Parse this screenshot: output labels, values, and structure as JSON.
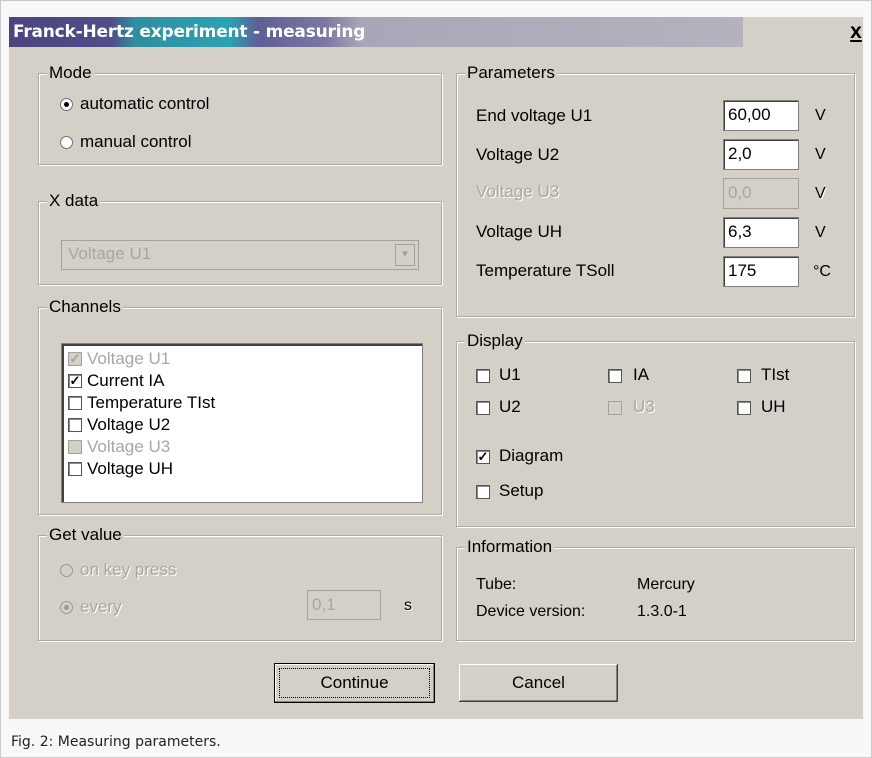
{
  "window": {
    "title": "Franck-Hertz experiment - measuring",
    "close_label": "x"
  },
  "mode": {
    "legend": "Mode",
    "options": [
      {
        "label": "automatic control",
        "selected": true
      },
      {
        "label": "manual control",
        "selected": false
      }
    ]
  },
  "x_data": {
    "legend": "X data",
    "value": "Voltage U1",
    "enabled": false
  },
  "channels": {
    "legend": "Channels",
    "items": [
      {
        "label": "Voltage U1",
        "checked": true,
        "enabled": false
      },
      {
        "label": "Current IA",
        "checked": true,
        "enabled": true
      },
      {
        "label": "Temperature TIst",
        "checked": false,
        "enabled": true
      },
      {
        "label": "Voltage U2",
        "checked": false,
        "enabled": true
      },
      {
        "label": "Voltage U3",
        "checked": false,
        "enabled": false
      },
      {
        "label": "Voltage UH",
        "checked": false,
        "enabled": true
      }
    ]
  },
  "get_value": {
    "legend": "Get value",
    "on_key_label": "on key press",
    "every_label": "every",
    "interval_value": "0,1",
    "interval_unit": "s",
    "enabled": false
  },
  "parameters": {
    "legend": "Parameters",
    "rows": [
      {
        "label": "End voltage U1",
        "value": "60,00",
        "unit": "V",
        "enabled": true
      },
      {
        "label": "Voltage U2",
        "value": "2,0",
        "unit": "V",
        "enabled": true
      },
      {
        "label": "Voltage U3",
        "value": "0,0",
        "unit": "V",
        "enabled": false
      },
      {
        "label": "Voltage UH",
        "value": "6,3",
        "unit": "V",
        "enabled": true
      },
      {
        "label": "Temperature TSoll",
        "value": "175",
        "unit": "°C",
        "enabled": true
      }
    ]
  },
  "display": {
    "legend": "Display",
    "u1": "U1",
    "ia": "IA",
    "tist": "TIst",
    "u2": "U2",
    "u3": "U3",
    "uh": "UH",
    "diagram": "Diagram",
    "setup": "Setup"
  },
  "information": {
    "legend": "Information",
    "tube_label": "Tube:",
    "tube_value": "Mercury",
    "version_label": "Device version:",
    "version_value": "1.3.0-1"
  },
  "buttons": {
    "continue": "Continue",
    "cancel": "Cancel"
  },
  "caption": "Fig. 2: Measuring parameters."
}
